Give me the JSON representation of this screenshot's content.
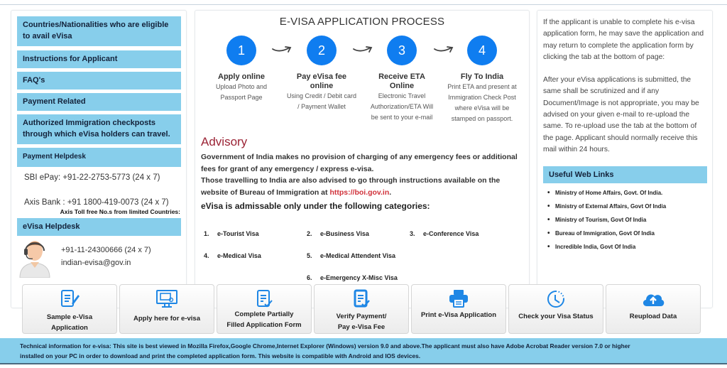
{
  "left": {
    "menu": [
      "Countries/Nationalities who are eligible to avail eVisa",
      "Instructions for Applicant",
      "FAQ's",
      "Payment Related",
      "Authorized Immigration checkposts through which eVisa holders can travel."
    ],
    "payment_helpdesk": {
      "heading": "Payment Helpdesk",
      "sbi": "SBI ePay: +91-22-2753-5773 (24 x 7)",
      "axis": "Axis Bank : +91 1800-419-0073 (24 x 7)",
      "axis_note": "Axis Toll free No.s from limited Countries:"
    },
    "evisa_helpdesk": {
      "heading": "eVisa Helpdesk",
      "phone": "+91-11-24300666 (24 x 7)",
      "email": "indian-evisa@gov.in",
      "avatar_icon": "support-agent-icon"
    }
  },
  "center": {
    "title": "E-VISA APPLICATION PROCESS",
    "steps": [
      {
        "number": "1",
        "title": "Apply online",
        "desc": "Upload Photo and Passport Page"
      },
      {
        "number": "2",
        "title": "Pay eVisa fee online",
        "desc": "Using Credit / Debit card / Payment Wallet"
      },
      {
        "number": "3",
        "title": "Receive ETA Online",
        "desc": "Electronic Travel Authorization/ETA Will be sent to your e-mail"
      },
      {
        "number": "4",
        "title": "Fly To India",
        "desc": "Print ETA and present at Immigration Check Post where eVisa will be stamped on passport."
      }
    ],
    "advisory": {
      "title": "Advisory",
      "para1": "Government of India makes no provision of charging of any emergency fees or additional fees for grant of any emergency / express e-visa.",
      "para2_prefix": "Those travelling to India are also advised to go through instructions available on the website of Bureau of Immigration at ",
      "link": "https://boi.gov.in",
      "para2_suffix": "."
    },
    "categories_heading": "eVisa is admissable only under the following categories:",
    "categories": [
      {
        "num": "1.",
        "label": "e-Tourist Visa"
      },
      {
        "num": "2.",
        "label": "e-Business Visa"
      },
      {
        "num": "3.",
        "label": "e-Conference Visa"
      },
      {
        "num": "4.",
        "label": "e-Medical Visa"
      },
      {
        "num": "5.",
        "label": "e-Medical Attendent Visa"
      },
      {
        "num": "6.",
        "label": "e-Emergency X-Misc Visa"
      }
    ]
  },
  "right": {
    "para1": "If the applicant is unable to complete his e-visa application form, he may save the application and may return to complete the application form by clicking the tab at the bottom of page:",
    "para2": "After your eVisa applications is submitted, the same shall be scrutinized and if any Document/Image is not appropriate, you may be advised on your given e-mail to re-upload the same. To re-upload use the tab at the bottom of the page. Applicant should normally receive this mail within 24 hours.",
    "links_heading": "Useful Web Links",
    "links": [
      "Ministry of Home Affairs, Govt. Of India.",
      "Ministry of External Affairs, Govt Of India",
      "Ministry of Tourism, Govt Of India",
      "Bureau of Immigration, Govt Of India",
      "Incredible India, Govt Of India"
    ]
  },
  "tiles": [
    {
      "label_1": "Sample e-Visa",
      "label_2": "Application",
      "icon": "document-edit-icon"
    },
    {
      "label_1": "Apply here for e-visa",
      "label_2": "",
      "icon": "computer-monitor-icon"
    },
    {
      "label_1": "Complete Partially",
      "label_2": "Filled Application Form",
      "icon": "document-check-icon"
    },
    {
      "label_1": "Verify Payment/",
      "label_2": "Pay e-Visa Fee",
      "icon": "document-check-filled-icon"
    },
    {
      "label_1": "Print e-Visa Application",
      "label_2": "",
      "icon": "printer-icon"
    },
    {
      "label_1": "Check your Visa Status",
      "label_2": "",
      "icon": "clock-icon"
    },
    {
      "label_1": "Reupload Data",
      "label_2": "",
      "icon": "cloud-upload-icon"
    }
  ],
  "footer": {
    "label": "Technical information for e-visa:",
    "line1": " This site is best viewed in Mozilla Firefox,Google Chrome,Internet Explorer (Windows) version 9.0 and above.The applicant must also have Adobe Acrobat Reader version 7.0 or higher",
    "line2": "installed on your PC in order to download and print the completed application form. This website is compatible with Android and IOS devices."
  },
  "colors": {
    "accent_blue": "#0f7df0",
    "menu_bg": "#87ceeb",
    "advisory_red": "#9b2335",
    "link_red": "#d0313a"
  }
}
